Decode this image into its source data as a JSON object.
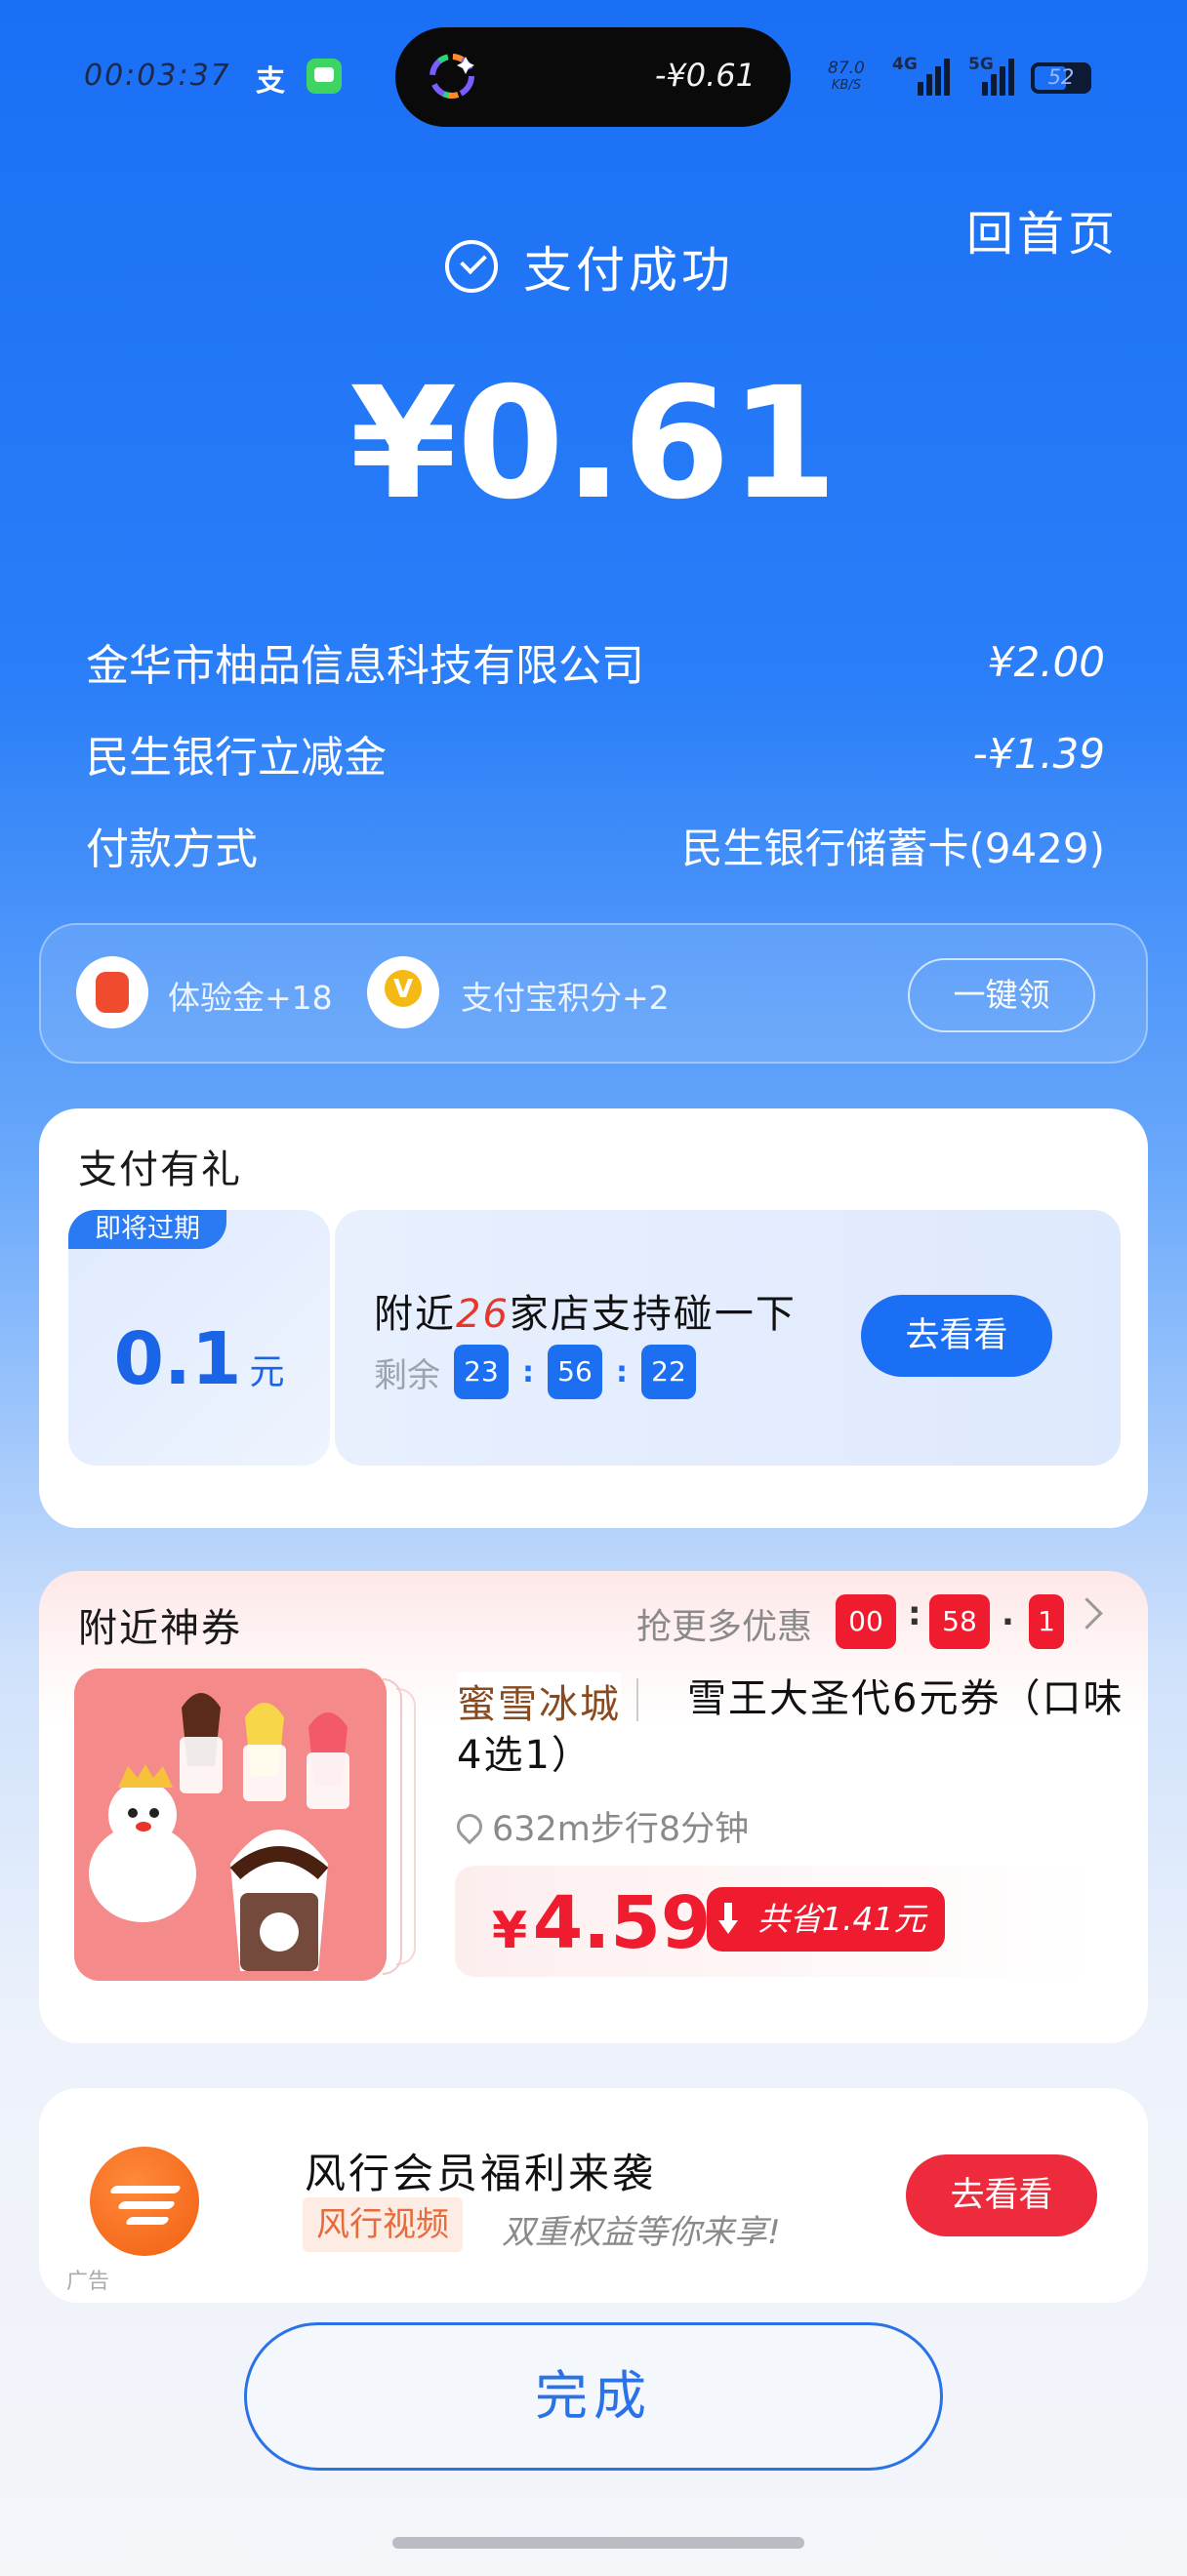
{
  "status_bar": {
    "time": "00:03:37",
    "island_amount": "-¥0.61",
    "net_speed": "87.0",
    "net_speed_unit": "KB/S",
    "signal_1": "4G",
    "signal_2": "5G",
    "battery": "52"
  },
  "header": {
    "home_link": "回首页",
    "success_text": "支付成功",
    "amount": "¥0.61"
  },
  "details": [
    {
      "label": "金华市柚品信息科技有限公司",
      "value": "¥2.00"
    },
    {
      "label": "民生银行立减金",
      "value": "-¥1.39"
    },
    {
      "label": "付款方式",
      "value": "民生银行储蓄卡(9429)"
    }
  ],
  "rewards": {
    "experience": "体验金+18",
    "points": "支付宝积分+2",
    "claim_button": "一键领"
  },
  "gift_card": {
    "title": "支付有礼",
    "expire_tag": "即将过期",
    "coupon_value": "0.1",
    "coupon_unit": "元",
    "nearby_prefix": "附近",
    "nearby_count": "26",
    "nearby_suffix": "家店支持碰一下",
    "remain_label": "剩余",
    "timer": [
      "23",
      "56",
      "22"
    ],
    "button": "去看看"
  },
  "voucher_card": {
    "title": "附近神券",
    "more_deals": "抢更多优惠",
    "timer": [
      "00",
      "58",
      "1"
    ],
    "brand": "蜜雪冰城",
    "product_title": "雪王大圣代6元券（口味4选1）",
    "distance": "632m步行8分钟",
    "price_symbol": "¥",
    "price": "4.59",
    "savings": "共省1.41元"
  },
  "ad_card": {
    "title": "风行会员福利来袭",
    "tag": "风行视频",
    "subtitle": "双重权益等你来享!",
    "button": "去看看",
    "ad_label": "广告"
  },
  "done_button": "完成",
  "colors": {
    "primary_blue": "#1a6ff5",
    "accent_red": "#ee1c2e",
    "success_white": "#ffffff"
  }
}
